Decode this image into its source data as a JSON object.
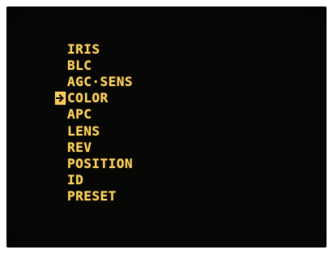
{
  "osd": {
    "menu_items": [
      {
        "label": "IRIS"
      },
      {
        "label": "BLC"
      },
      {
        "label": "AGC·SENS"
      },
      {
        "label": "COLOR",
        "selected": true
      },
      {
        "label": "APC"
      },
      {
        "label": "LENS"
      },
      {
        "label": "REV"
      },
      {
        "label": "POSITION"
      },
      {
        "label": "ID"
      },
      {
        "label": "PRESET"
      }
    ],
    "cursor_icon": "right-arrow-icon",
    "colors": {
      "text": "#f1c85a",
      "background": "#070706"
    }
  }
}
